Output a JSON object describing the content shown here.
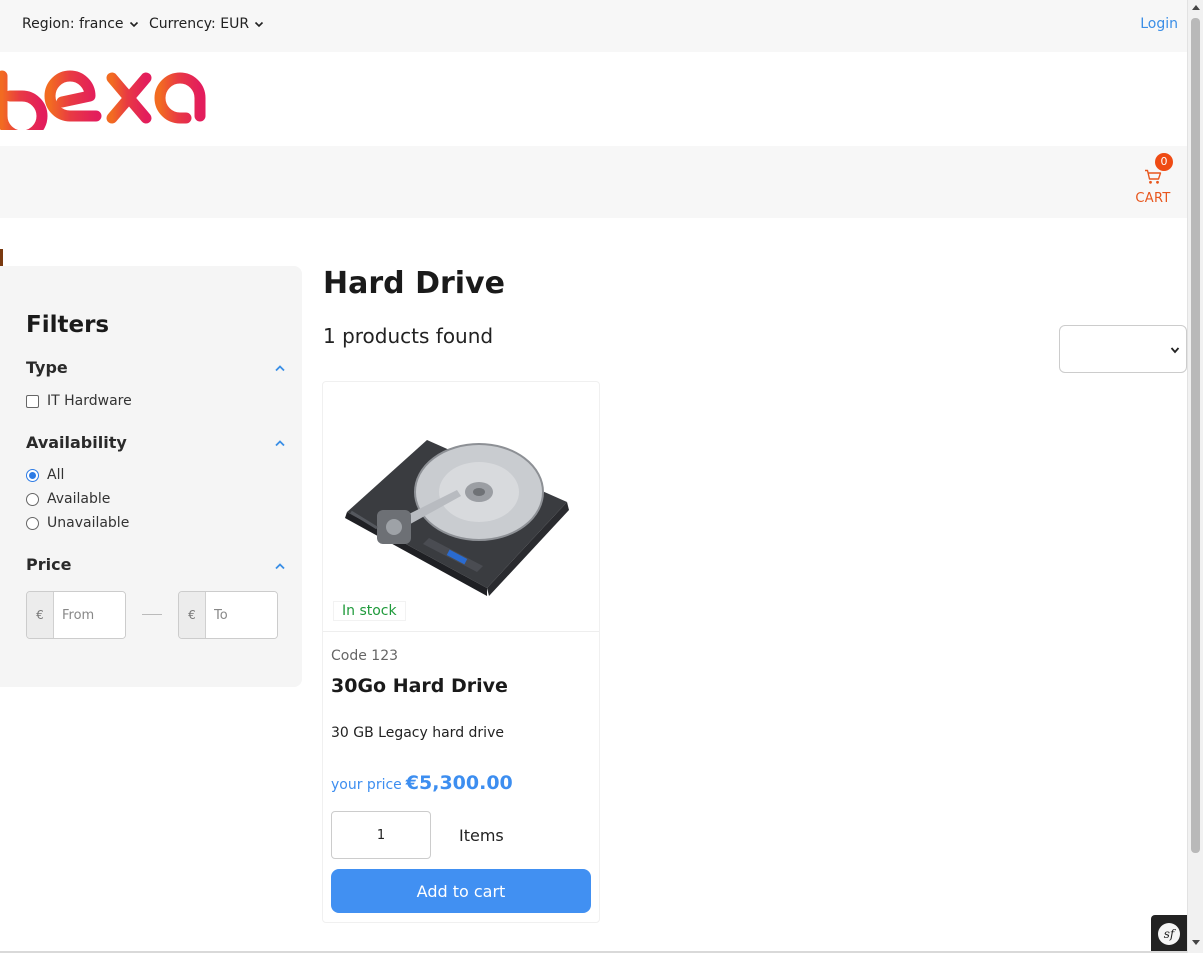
{
  "header": {
    "region_label": "Region: france",
    "currency_label": "Currency: EUR",
    "login_label": "Login"
  },
  "brand": {
    "logo_alt": "ibexa",
    "logo_colors": [
      "#f26b21",
      "#e31d5c"
    ]
  },
  "cart": {
    "count": "0",
    "label": "CART",
    "icon": "cart-icon",
    "accent_color": "#e8561d"
  },
  "filters": {
    "title": "Filters",
    "type": {
      "title": "Type",
      "options": [
        {
          "label": "IT Hardware",
          "checked": false
        }
      ]
    },
    "availability": {
      "title": "Availability",
      "options": [
        {
          "label": "All",
          "selected": true
        },
        {
          "label": "Available",
          "selected": false
        },
        {
          "label": "Unavailable",
          "selected": false
        }
      ]
    },
    "price": {
      "title": "Price",
      "currency_symbol": "€",
      "from_placeholder": "From",
      "to_placeholder": "To"
    }
  },
  "main": {
    "title": "Hard Drive",
    "results_count": "1 products found",
    "sort_value": ""
  },
  "products": [
    {
      "stock": "In stock",
      "code": "Code 123",
      "name": "30Go Hard Drive",
      "description": "30 GB Legacy hard drive",
      "price_label": "your price",
      "price": "€5,300.00",
      "quantity": "1",
      "quantity_unit": "Items",
      "add_to_cart_label": "Add to cart"
    }
  ],
  "colors": {
    "accent_blue": "#4190f2",
    "stock_green": "#1f9a3b",
    "link_blue": "#3a8ee6"
  }
}
